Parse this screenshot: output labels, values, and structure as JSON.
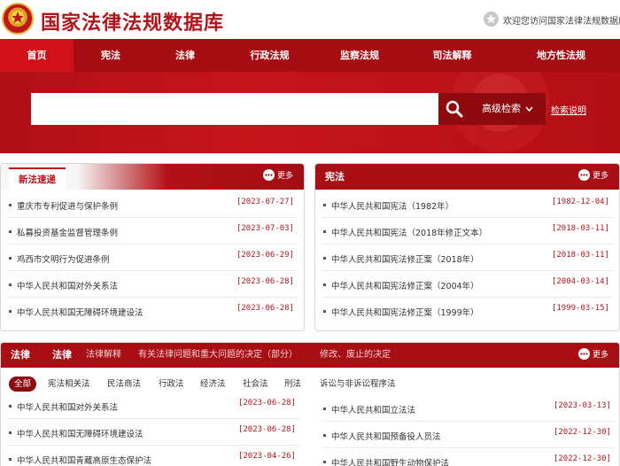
{
  "header": {
    "site_title": "国家法律法规数据库",
    "welcome": "欢迎您访问国家法律法规数据库"
  },
  "nav": [
    "首页",
    "宪法",
    "法律",
    "行政法规",
    "监察法规",
    "司法解释",
    "地方性法规"
  ],
  "search": {
    "placeholder": "",
    "advanced_label": "高级检索",
    "help_label": "检索说明"
  },
  "news": {
    "tab": "新法速递",
    "more": "更多",
    "items": [
      {
        "title": "重庆市专利促进与保护条例",
        "date": "[2023-07-27]"
      },
      {
        "title": "私募投资基金监督管理条例",
        "date": "[2023-07-03]"
      },
      {
        "title": "鸡西市文明行为促进条例",
        "date": "[2023-06-29]"
      },
      {
        "title": "中华人民共和国对外关系法",
        "date": "[2023-06-28]"
      },
      {
        "title": "中华人民共和国无障碍环境建设法",
        "date": "[2023-06-28]"
      }
    ]
  },
  "constitution": {
    "title": "宪法",
    "more": "更多",
    "items": [
      {
        "title": "中华人民共和国宪法（1982年）",
        "date": "[1982-12-04]"
      },
      {
        "title": "中华人民共和国宪法（2018年修正文本）",
        "date": "[2018-03-11]"
      },
      {
        "title": "中华人民共和国宪法修正案（2018年）",
        "date": "[2018-03-11]"
      },
      {
        "title": "中华人民共和国宪法修正案（2004年）",
        "date": "[2004-03-14]"
      },
      {
        "title": "中华人民共和国宪法修正案（1999年）",
        "date": "[1999-03-15]"
      }
    ]
  },
  "law": {
    "title": "法律",
    "tabs": [
      "法律",
      "法律解释",
      "有关法律问题和重大问题的决定（部分）",
      "修改、废止的决定"
    ],
    "more": "更多",
    "categories": [
      "全部",
      "宪法相关法",
      "民法商法",
      "行政法",
      "经济法",
      "社会法",
      "刑法",
      "诉讼与非诉讼程序法"
    ],
    "left_items": [
      {
        "title": "中华人民共和国对外关系法",
        "date": "[2023-06-28]"
      },
      {
        "title": "中华人民共和国无障碍环境建设法",
        "date": "[2023-06-28]"
      },
      {
        "title": "中华人民共和国青藏高原生态保护法",
        "date": "[2023-04-26]"
      }
    ],
    "right_items": [
      {
        "title": "中华人民共和国立法法",
        "date": "[2023-03-13]"
      },
      {
        "title": "中华人民共和国预备役人员法",
        "date": "[2022-12-30]"
      },
      {
        "title": "中华人民共和国野生动物保护法",
        "date": "[2022-12-30]"
      }
    ]
  }
}
